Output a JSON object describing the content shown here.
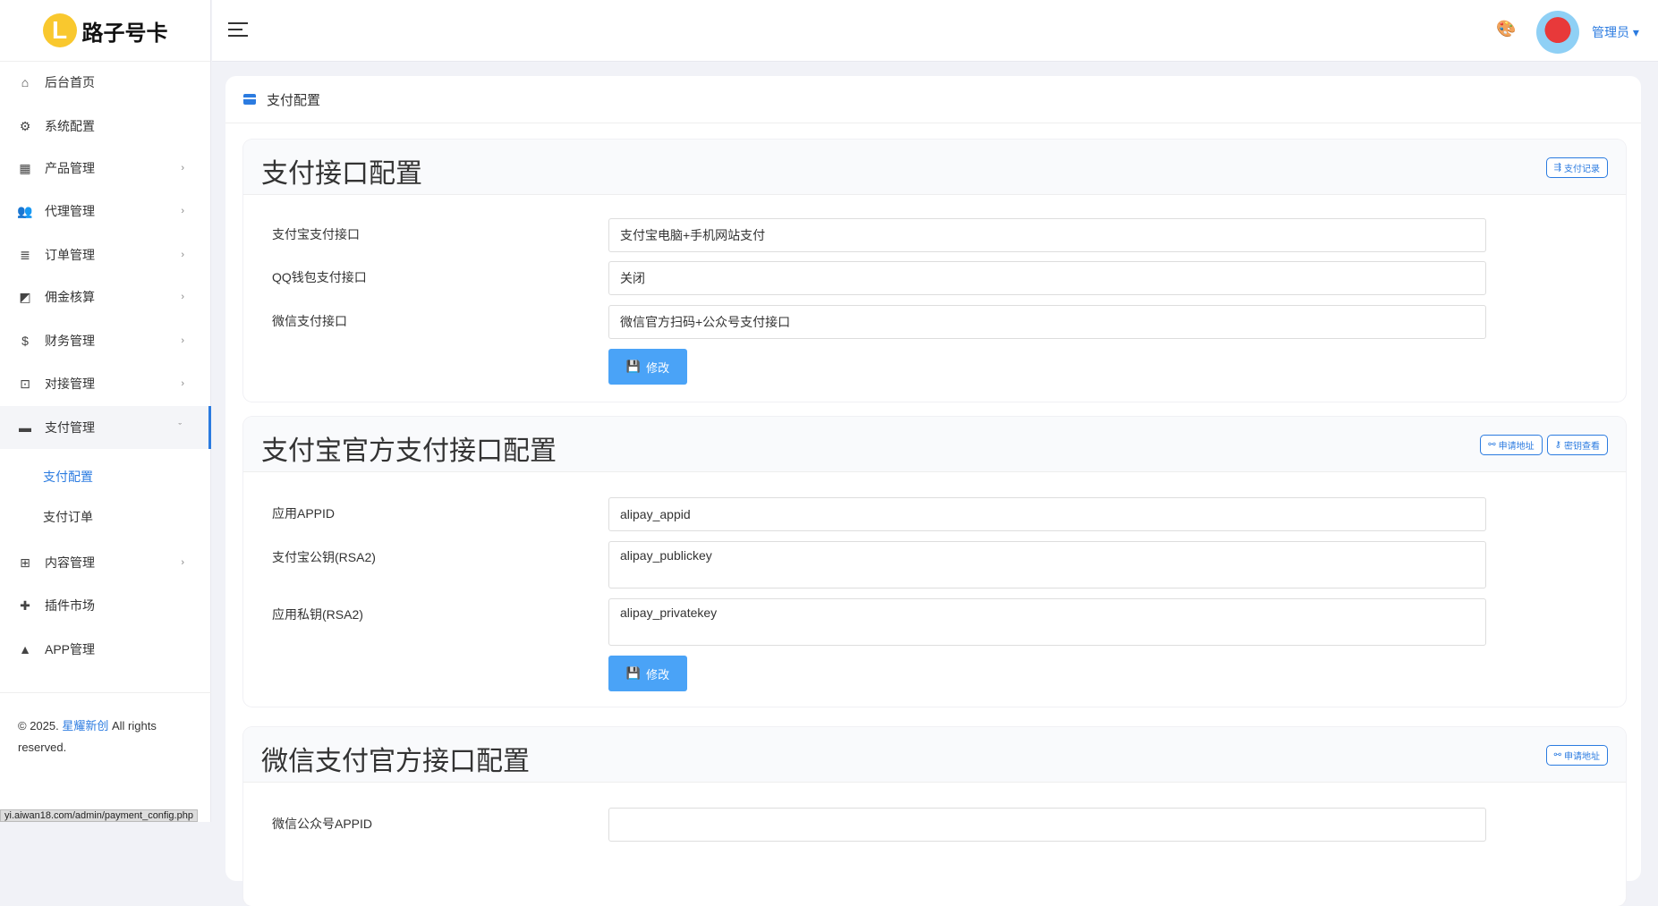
{
  "logo": {
    "letter": "L",
    "text": "路子号卡"
  },
  "sidebar": {
    "items": [
      {
        "label": "后台首页",
        "icon": "⌂"
      },
      {
        "label": "系统配置",
        "icon": "⚙"
      },
      {
        "label": "产品管理",
        "icon": "▦",
        "chev": "›"
      },
      {
        "label": "代理管理",
        "icon": "👥",
        "chev": "›"
      },
      {
        "label": "订单管理",
        "icon": "≣",
        "chev": "›"
      },
      {
        "label": "佣金核算",
        "icon": "◩",
        "chev": "›"
      },
      {
        "label": "财务管理",
        "icon": "$",
        "chev": "›"
      },
      {
        "label": "对接管理",
        "icon": "⊡",
        "chev": "›"
      },
      {
        "label": "支付管理",
        "icon": "▬",
        "chev": "ˇ"
      },
      {
        "label": "内容管理",
        "icon": "⊞",
        "chev": "›"
      },
      {
        "label": "插件市场",
        "icon": "✚"
      },
      {
        "label": "APP管理",
        "icon": "▲"
      }
    ],
    "subitems": [
      {
        "label": "支付配置"
      },
      {
        "label": "支付订单"
      }
    ],
    "footer": {
      "prefix": "© 2025.",
      "link": "星耀新创",
      "suffix": "All rights reserved."
    }
  },
  "status_url": "yi.aiwan18.com/admin/payment_config.php",
  "header": {
    "user": "管理员",
    "caret": "▾",
    "palette_icon": "🎨"
  },
  "page": {
    "title": "支付配置"
  },
  "sections": [
    {
      "title": "支付接口配置",
      "buttons": [
        "支付记录"
      ],
      "fields": [
        {
          "label": "支付宝支付接口",
          "value": "支付宝电脑+手机网站支付"
        },
        {
          "label": "QQ钱包支付接口",
          "value": "关闭"
        },
        {
          "label": "微信支付接口",
          "value": "微信官方扫码+公众号支付接口"
        }
      ],
      "save": "修改"
    },
    {
      "title": "支付宝官方支付接口配置",
      "buttons": [
        "申请地址",
        "密钥查看"
      ],
      "fields": [
        {
          "label": "应用APPID",
          "value": "alipay_appid"
        },
        {
          "label": "支付宝公钥(RSA2)",
          "value": "alipay_publickey"
        },
        {
          "label": "应用私钥(RSA2)",
          "value": "alipay_privatekey"
        }
      ],
      "save": "修改"
    },
    {
      "title": "微信支付官方接口配置",
      "buttons": [
        "申请地址"
      ],
      "fields": [
        {
          "label": "微信公众号APPID",
          "value": ""
        }
      ]
    }
  ]
}
